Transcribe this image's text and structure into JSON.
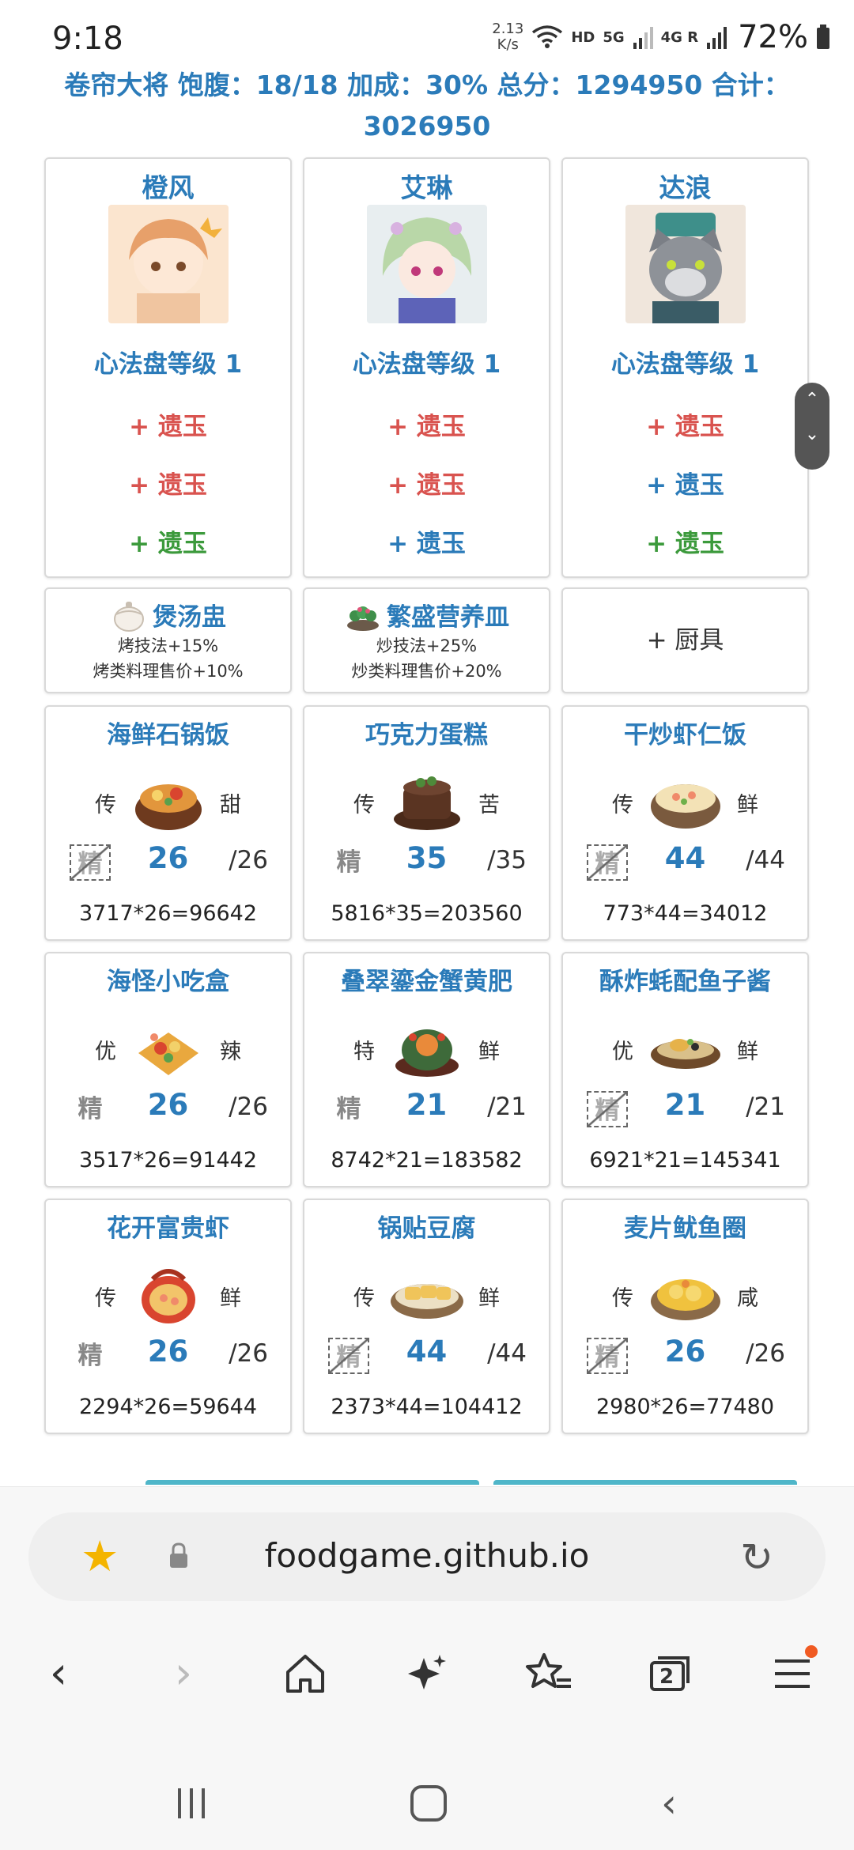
{
  "status": {
    "time": "9:18",
    "speed_value": "2.13",
    "speed_unit": "K/s",
    "hd": "HD",
    "net1": "5G",
    "net2": "4G R",
    "battery": "72%"
  },
  "header": {
    "line1": "卷帘大将 饱腹：18/18 加成：30% 总分：1294950 合计：",
    "line2": "3026950"
  },
  "chefs": [
    {
      "name": "橙风",
      "level": "心法盘等级 1",
      "jades": [
        {
          "label": "+ 遗玉",
          "color": "red"
        },
        {
          "label": "+ 遗玉",
          "color": "red"
        },
        {
          "label": "+ 遗玉",
          "color": "green"
        }
      ]
    },
    {
      "name": "艾琳",
      "level": "心法盘等级 1",
      "jades": [
        {
          "label": "+ 遗玉",
          "color": "red"
        },
        {
          "label": "+ 遗玉",
          "color": "red"
        },
        {
          "label": "+ 遗玉",
          "color": "blue"
        }
      ]
    },
    {
      "name": "达浪",
      "level": "心法盘等级 1",
      "jades": [
        {
          "label": "+ 遗玉",
          "color": "red"
        },
        {
          "label": "+ 遗玉",
          "color": "blue"
        },
        {
          "label": "+ 遗玉",
          "color": "green"
        }
      ]
    }
  ],
  "equipment": [
    {
      "name": "煲汤盅",
      "line1": "烤技法+15%",
      "line2": "烤类料理售价+10%"
    },
    {
      "name": "繁盛营养皿",
      "line1": "炒技法+25%",
      "line2": "炒类料理售价+20%"
    },
    {
      "add_label": "+ 厨具"
    }
  ],
  "dishes": [
    {
      "name": "海鲜石锅饭",
      "rank": "传",
      "taste": "甜",
      "skill": "精",
      "skill_style": "dashed",
      "qty": "26",
      "limit": "/26",
      "formula": "3717*26=96642"
    },
    {
      "name": "巧克力蛋糕",
      "rank": "传",
      "taste": "苦",
      "skill": "精",
      "skill_style": "plain",
      "qty": "35",
      "limit": "/35",
      "formula": "5816*35=203560"
    },
    {
      "name": "干炒虾仁饭",
      "rank": "传",
      "taste": "鲜",
      "skill": "精",
      "skill_style": "dashed",
      "qty": "44",
      "limit": "/44",
      "formula": "773*44=34012"
    },
    {
      "name": "海怪小吃盒",
      "rank": "优",
      "taste": "辣",
      "skill": "精",
      "skill_style": "plain",
      "qty": "26",
      "limit": "/26",
      "formula": "3517*26=91442"
    },
    {
      "name": "叠翠鎏金蟹黄肥",
      "rank": "特",
      "taste": "鲜",
      "skill": "精",
      "skill_style": "plain",
      "qty": "21",
      "limit": "/21",
      "formula": "8742*21=183582"
    },
    {
      "name": "酥炸蚝配鱼子酱",
      "rank": "优",
      "taste": "鲜",
      "skill": "精",
      "skill_style": "dashed",
      "qty": "21",
      "limit": "/21",
      "formula": "6921*21=145341"
    },
    {
      "name": "花开富贵虾",
      "rank": "传",
      "taste": "鲜",
      "skill": "精",
      "skill_style": "plain",
      "qty": "26",
      "limit": "/26",
      "formula": "2294*26=59644"
    },
    {
      "name": "锅贴豆腐",
      "rank": "传",
      "taste": "鲜",
      "skill": "精",
      "skill_style": "dashed",
      "qty": "44",
      "limit": "/44",
      "formula": "2373*44=104412"
    },
    {
      "name": "麦片鱿鱼圈",
      "rank": "传",
      "taste": "咸",
      "skill": "精",
      "skill_style": "dashed",
      "qty": "26",
      "limit": "/26",
      "formula": "2980*26=77480"
    }
  ],
  "browser": {
    "url": "foodgame.github.io",
    "tabs_count": "2"
  },
  "colors": {
    "accent_blue": "#2b7bb9",
    "red": "#d9534f",
    "green": "#3c9a3c",
    "star": "#f4b400",
    "badge": "#f05a22"
  }
}
